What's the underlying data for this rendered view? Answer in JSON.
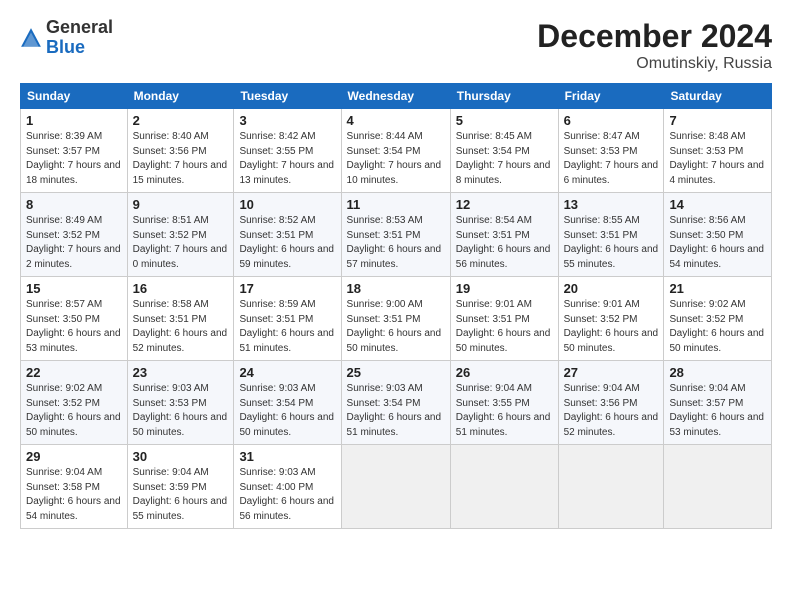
{
  "logo": {
    "line1": "General",
    "line2": "Blue"
  },
  "title": "December 2024",
  "subtitle": "Omutinskiy, Russia",
  "headers": [
    "Sunday",
    "Monday",
    "Tuesday",
    "Wednesday",
    "Thursday",
    "Friday",
    "Saturday"
  ],
  "weeks": [
    [
      {
        "day": "1",
        "rise": "Sunrise: 8:39 AM",
        "set": "Sunset: 3:57 PM",
        "daylight": "Daylight: 7 hours and 18 minutes."
      },
      {
        "day": "2",
        "rise": "Sunrise: 8:40 AM",
        "set": "Sunset: 3:56 PM",
        "daylight": "Daylight: 7 hours and 15 minutes."
      },
      {
        "day": "3",
        "rise": "Sunrise: 8:42 AM",
        "set": "Sunset: 3:55 PM",
        "daylight": "Daylight: 7 hours and 13 minutes."
      },
      {
        "day": "4",
        "rise": "Sunrise: 8:44 AM",
        "set": "Sunset: 3:54 PM",
        "daylight": "Daylight: 7 hours and 10 minutes."
      },
      {
        "day": "5",
        "rise": "Sunrise: 8:45 AM",
        "set": "Sunset: 3:54 PM",
        "daylight": "Daylight: 7 hours and 8 minutes."
      },
      {
        "day": "6",
        "rise": "Sunrise: 8:47 AM",
        "set": "Sunset: 3:53 PM",
        "daylight": "Daylight: 7 hours and 6 minutes."
      },
      {
        "day": "7",
        "rise": "Sunrise: 8:48 AM",
        "set": "Sunset: 3:53 PM",
        "daylight": "Daylight: 7 hours and 4 minutes."
      }
    ],
    [
      {
        "day": "8",
        "rise": "Sunrise: 8:49 AM",
        "set": "Sunset: 3:52 PM",
        "daylight": "Daylight: 7 hours and 2 minutes."
      },
      {
        "day": "9",
        "rise": "Sunrise: 8:51 AM",
        "set": "Sunset: 3:52 PM",
        "daylight": "Daylight: 7 hours and 0 minutes."
      },
      {
        "day": "10",
        "rise": "Sunrise: 8:52 AM",
        "set": "Sunset: 3:51 PM",
        "daylight": "Daylight: 6 hours and 59 minutes."
      },
      {
        "day": "11",
        "rise": "Sunrise: 8:53 AM",
        "set": "Sunset: 3:51 PM",
        "daylight": "Daylight: 6 hours and 57 minutes."
      },
      {
        "day": "12",
        "rise": "Sunrise: 8:54 AM",
        "set": "Sunset: 3:51 PM",
        "daylight": "Daylight: 6 hours and 56 minutes."
      },
      {
        "day": "13",
        "rise": "Sunrise: 8:55 AM",
        "set": "Sunset: 3:51 PM",
        "daylight": "Daylight: 6 hours and 55 minutes."
      },
      {
        "day": "14",
        "rise": "Sunrise: 8:56 AM",
        "set": "Sunset: 3:50 PM",
        "daylight": "Daylight: 6 hours and 54 minutes."
      }
    ],
    [
      {
        "day": "15",
        "rise": "Sunrise: 8:57 AM",
        "set": "Sunset: 3:50 PM",
        "daylight": "Daylight: 6 hours and 53 minutes."
      },
      {
        "day": "16",
        "rise": "Sunrise: 8:58 AM",
        "set": "Sunset: 3:51 PM",
        "daylight": "Daylight: 6 hours and 52 minutes."
      },
      {
        "day": "17",
        "rise": "Sunrise: 8:59 AM",
        "set": "Sunset: 3:51 PM",
        "daylight": "Daylight: 6 hours and 51 minutes."
      },
      {
        "day": "18",
        "rise": "Sunrise: 9:00 AM",
        "set": "Sunset: 3:51 PM",
        "daylight": "Daylight: 6 hours and 50 minutes."
      },
      {
        "day": "19",
        "rise": "Sunrise: 9:01 AM",
        "set": "Sunset: 3:51 PM",
        "daylight": "Daylight: 6 hours and 50 minutes."
      },
      {
        "day": "20",
        "rise": "Sunrise: 9:01 AM",
        "set": "Sunset: 3:52 PM",
        "daylight": "Daylight: 6 hours and 50 minutes."
      },
      {
        "day": "21",
        "rise": "Sunrise: 9:02 AM",
        "set": "Sunset: 3:52 PM",
        "daylight": "Daylight: 6 hours and 50 minutes."
      }
    ],
    [
      {
        "day": "22",
        "rise": "Sunrise: 9:02 AM",
        "set": "Sunset: 3:52 PM",
        "daylight": "Daylight: 6 hours and 50 minutes."
      },
      {
        "day": "23",
        "rise": "Sunrise: 9:03 AM",
        "set": "Sunset: 3:53 PM",
        "daylight": "Daylight: 6 hours and 50 minutes."
      },
      {
        "day": "24",
        "rise": "Sunrise: 9:03 AM",
        "set": "Sunset: 3:54 PM",
        "daylight": "Daylight: 6 hours and 50 minutes."
      },
      {
        "day": "25",
        "rise": "Sunrise: 9:03 AM",
        "set": "Sunset: 3:54 PM",
        "daylight": "Daylight: 6 hours and 51 minutes."
      },
      {
        "day": "26",
        "rise": "Sunrise: 9:04 AM",
        "set": "Sunset: 3:55 PM",
        "daylight": "Daylight: 6 hours and 51 minutes."
      },
      {
        "day": "27",
        "rise": "Sunrise: 9:04 AM",
        "set": "Sunset: 3:56 PM",
        "daylight": "Daylight: 6 hours and 52 minutes."
      },
      {
        "day": "28",
        "rise": "Sunrise: 9:04 AM",
        "set": "Sunset: 3:57 PM",
        "daylight": "Daylight: 6 hours and 53 minutes."
      }
    ],
    [
      {
        "day": "29",
        "rise": "Sunrise: 9:04 AM",
        "set": "Sunset: 3:58 PM",
        "daylight": "Daylight: 6 hours and 54 minutes."
      },
      {
        "day": "30",
        "rise": "Sunrise: 9:04 AM",
        "set": "Sunset: 3:59 PM",
        "daylight": "Daylight: 6 hours and 55 minutes."
      },
      {
        "day": "31",
        "rise": "Sunrise: 9:03 AM",
        "set": "Sunset: 4:00 PM",
        "daylight": "Daylight: 6 hours and 56 minutes."
      },
      null,
      null,
      null,
      null
    ]
  ]
}
